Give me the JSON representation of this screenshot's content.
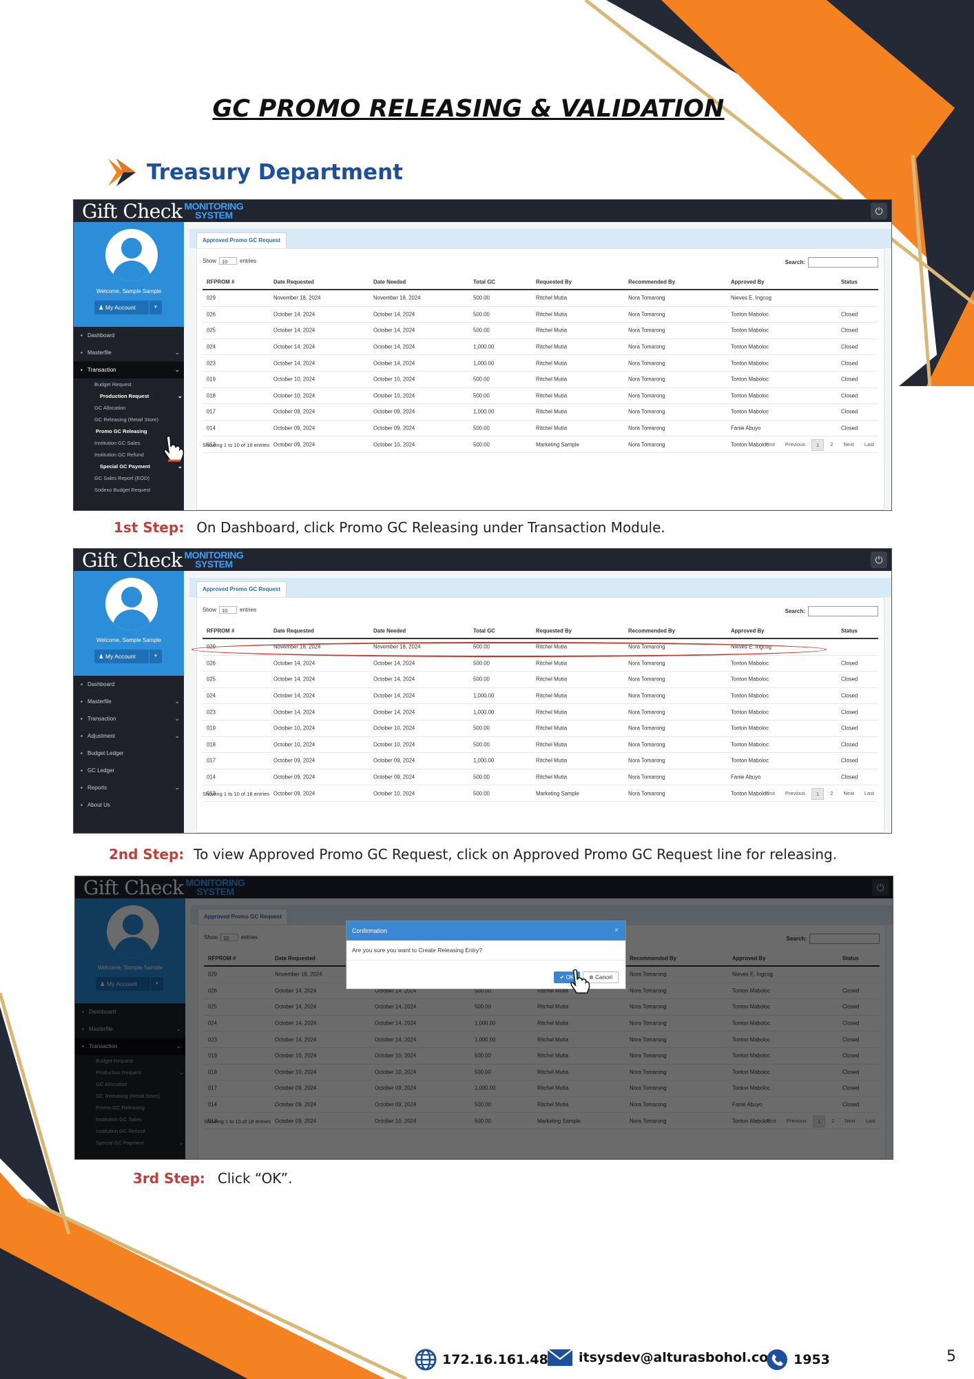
{
  "document": {
    "title": "GC PROMO RELEASING & VALIDATION",
    "department": "Treasury Department",
    "page_number": "5"
  },
  "app": {
    "brand_gift": "Gift Check",
    "brand_line1": "MONITORING",
    "brand_line2": "SYSTEM",
    "welcome": "Welcome, Sample Sample",
    "account_label": "My Account",
    "tab_label": "Approved Promo GC Request",
    "show_label": "Show",
    "entries_value": "10",
    "entries_label": "entries",
    "search_label": "Search:",
    "showing_text": "Showing 1 to 10 of 18 entries",
    "pagination": [
      "First",
      "Previous",
      "1",
      "2",
      "Next",
      "Last"
    ]
  },
  "menus": {
    "menu_a": [
      {
        "label": "Dashboard",
        "icon": "dashboard-icon",
        "chevron": false,
        "active": false
      },
      {
        "label": "Masterfile",
        "icon": "list-icon",
        "chevron": true,
        "active": false
      },
      {
        "label": "Transaction",
        "icon": "transaction-icon",
        "chevron": true,
        "active": true
      }
    ],
    "submenu_a": [
      {
        "label": "Budget Request",
        "type": "normal",
        "chevron": false
      },
      {
        "label": "Production Request",
        "type": "hl",
        "chevron": true
      },
      {
        "label": "GC Allocation",
        "type": "normal",
        "chevron": false
      },
      {
        "label": "GC Releasing (Retail Store)",
        "type": "normal",
        "chevron": false
      },
      {
        "label": "Promo GC Releasing",
        "type": "cur",
        "chevron": false
      },
      {
        "label": "Institution GC Sales",
        "type": "normal",
        "chevron": false
      },
      {
        "label": "Institution GC Refund",
        "type": "normal",
        "chevron": false
      },
      {
        "label": "Special GC Payment",
        "type": "hl",
        "chevron": true
      },
      {
        "label": "GC Sales Report (EOD)",
        "type": "normal",
        "chevron": false
      },
      {
        "label": "Sodexo Budget Request",
        "type": "normal",
        "chevron": false
      }
    ],
    "menu_b": [
      {
        "label": "Dashboard",
        "icon": "dashboard-icon",
        "chevron": false
      },
      {
        "label": "Masterfile",
        "icon": "list-icon",
        "chevron": true
      },
      {
        "label": "Transaction",
        "icon": "transaction-icon",
        "chevron": true
      },
      {
        "label": "Adjustment",
        "icon": "exchange-icon",
        "chevron": true
      },
      {
        "label": "Budget Ledger",
        "icon": "ledger-icon",
        "chevron": false
      },
      {
        "label": "GC Ledger",
        "icon": "ledger-icon",
        "chevron": false
      },
      {
        "label": "Reports",
        "icon": "report-icon",
        "chevron": true
      },
      {
        "label": "About Us",
        "icon": "info-icon",
        "chevron": false
      }
    ],
    "submenu_c": [
      {
        "label": "Budget Request",
        "type": "normal",
        "chevron": false
      },
      {
        "label": "Production Request",
        "type": "normal",
        "chevron": true
      },
      {
        "label": "GC Allocation",
        "type": "normal",
        "chevron": false
      },
      {
        "label": "GC Releasing (Retail Store)",
        "type": "normal",
        "chevron": false
      },
      {
        "label": "Promo GC Releasing",
        "type": "normal",
        "chevron": false
      },
      {
        "label": "Institution GC Sales",
        "type": "normal",
        "chevron": false
      },
      {
        "label": "Institution GC Refund",
        "type": "normal",
        "chevron": false
      },
      {
        "label": "Special GC Payment",
        "type": "normal",
        "chevron": true
      }
    ]
  },
  "table": {
    "headers": [
      "RFPROM #",
      "Date Requested",
      "Date Needed",
      "Total GC",
      "Requested By",
      "Recommended By",
      "Approved By",
      "Status"
    ],
    "rows": [
      [
        "029",
        "November 18, 2024",
        "November 18, 2024",
        "500.00",
        "Ritchel Mutia",
        "Nora Tomarong",
        "Nieves E. Ingcog",
        ""
      ],
      [
        "026",
        "October 14, 2024",
        "October 14, 2024",
        "500.00",
        "Ritchel Mutia",
        "Nora Tomarong",
        "Tonton Maboloc",
        "Closed"
      ],
      [
        "025",
        "October 14, 2024",
        "October 14, 2024",
        "500.00",
        "Ritchel Mutia",
        "Nora Tomarong",
        "Tonton Maboloc",
        "Closed"
      ],
      [
        "024",
        "October 14, 2024",
        "October 14, 2024",
        "1,000.00",
        "Ritchel Mutia",
        "Nora Tomarong",
        "Tonton Maboloc",
        "Closed"
      ],
      [
        "023",
        "October 14, 2024",
        "October 14, 2024",
        "1,000.00",
        "Ritchel Mutia",
        "Nora Tomarong",
        "Tonton Maboloc",
        "Closed"
      ],
      [
        "019",
        "October 10, 2024",
        "October 10, 2024",
        "500.00",
        "Ritchel Mutia",
        "Nora Tomarong",
        "Tonton Maboloc",
        "Closed"
      ],
      [
        "018",
        "October 10, 2024",
        "October 10, 2024",
        "500.00",
        "Ritchel Mutia",
        "Nora Tomarong",
        "Tonton Maboloc",
        "Closed"
      ],
      [
        "017",
        "October 09, 2024",
        "October 09, 2024",
        "1,000.00",
        "Ritchel Mutia",
        "Nora Tomarong",
        "Tonton Maboloc",
        "Closed"
      ],
      [
        "014",
        "October 09, 2024",
        "October 09, 2024",
        "500.00",
        "Ritchel Mutia",
        "Nora Tomarong",
        "Fanie Abuyo",
        "Closed"
      ],
      [
        "013",
        "October 09, 2024",
        "October 10, 2024",
        "500.00",
        "Marketing Sample",
        "Nora Tomarong",
        "Tonton Maboloc",
        ""
      ]
    ]
  },
  "modal": {
    "title": "Confirmation",
    "close": "×",
    "message": "Are you sure you want to Create Releasing Entry?",
    "ok_label": "OK",
    "cancel_label": "Cancel"
  },
  "steps": {
    "s1_label": "1st Step:",
    "s1_text": "On Dashboard, click Promo GC Releasing under Transaction Module.",
    "s2_label": "2nd Step:",
    "s2_text": "To view Approved Promo GC Request, click on Approved Promo GC Request line for releasing.",
    "s3_label": "3rd Step:",
    "s3_text": "Click “OK”."
  },
  "contacts": {
    "ip": "172.16.161.48",
    "email": "itsysdev@alturasbohol.com",
    "phone": "1953"
  },
  "colors": {
    "orange": "#f58220",
    "navy": "#242a35",
    "gold": "#d9b877",
    "brand_blue": "#1c4f9c",
    "step_red": "#c93b36",
    "sidebar_blue": "#2c8dd8"
  }
}
